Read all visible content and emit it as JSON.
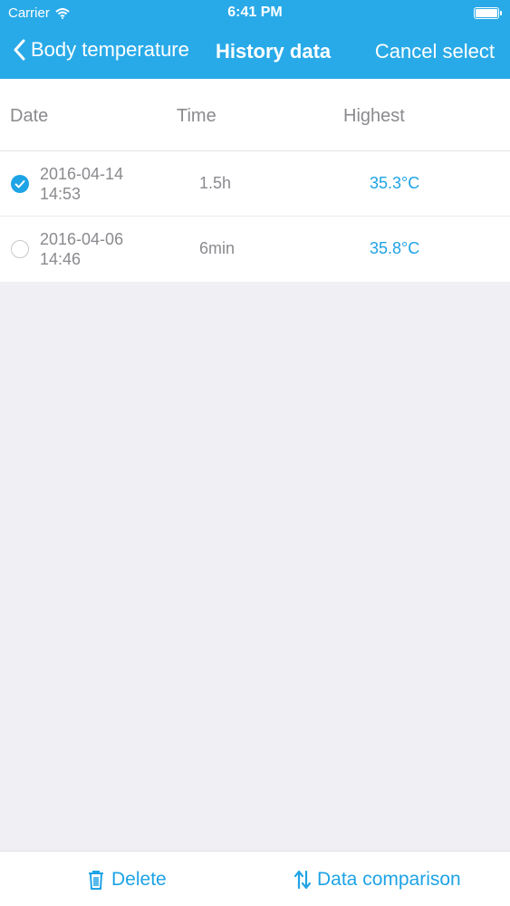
{
  "status_bar": {
    "carrier": "Carrier",
    "time": "6:41 PM"
  },
  "nav": {
    "back_label": "Body temperature",
    "title": "History data",
    "action_label": "Cancel select"
  },
  "table": {
    "headers": {
      "date": "Date",
      "time": "Time",
      "highest": "Highest"
    },
    "rows": [
      {
        "selected": true,
        "date": "2016-04-14",
        "clock": "14:53",
        "duration": "1.5h",
        "highest": "35.3°C"
      },
      {
        "selected": false,
        "date": "2016-04-06",
        "clock": "14:46",
        "duration": "6min",
        "highest": "35.8°C"
      }
    ]
  },
  "toolbar": {
    "delete_label": "Delete",
    "compare_label": "Data comparison"
  },
  "colors": {
    "accent": "#29aae8",
    "value": "#1ea3e6",
    "background": "#efeff4"
  }
}
